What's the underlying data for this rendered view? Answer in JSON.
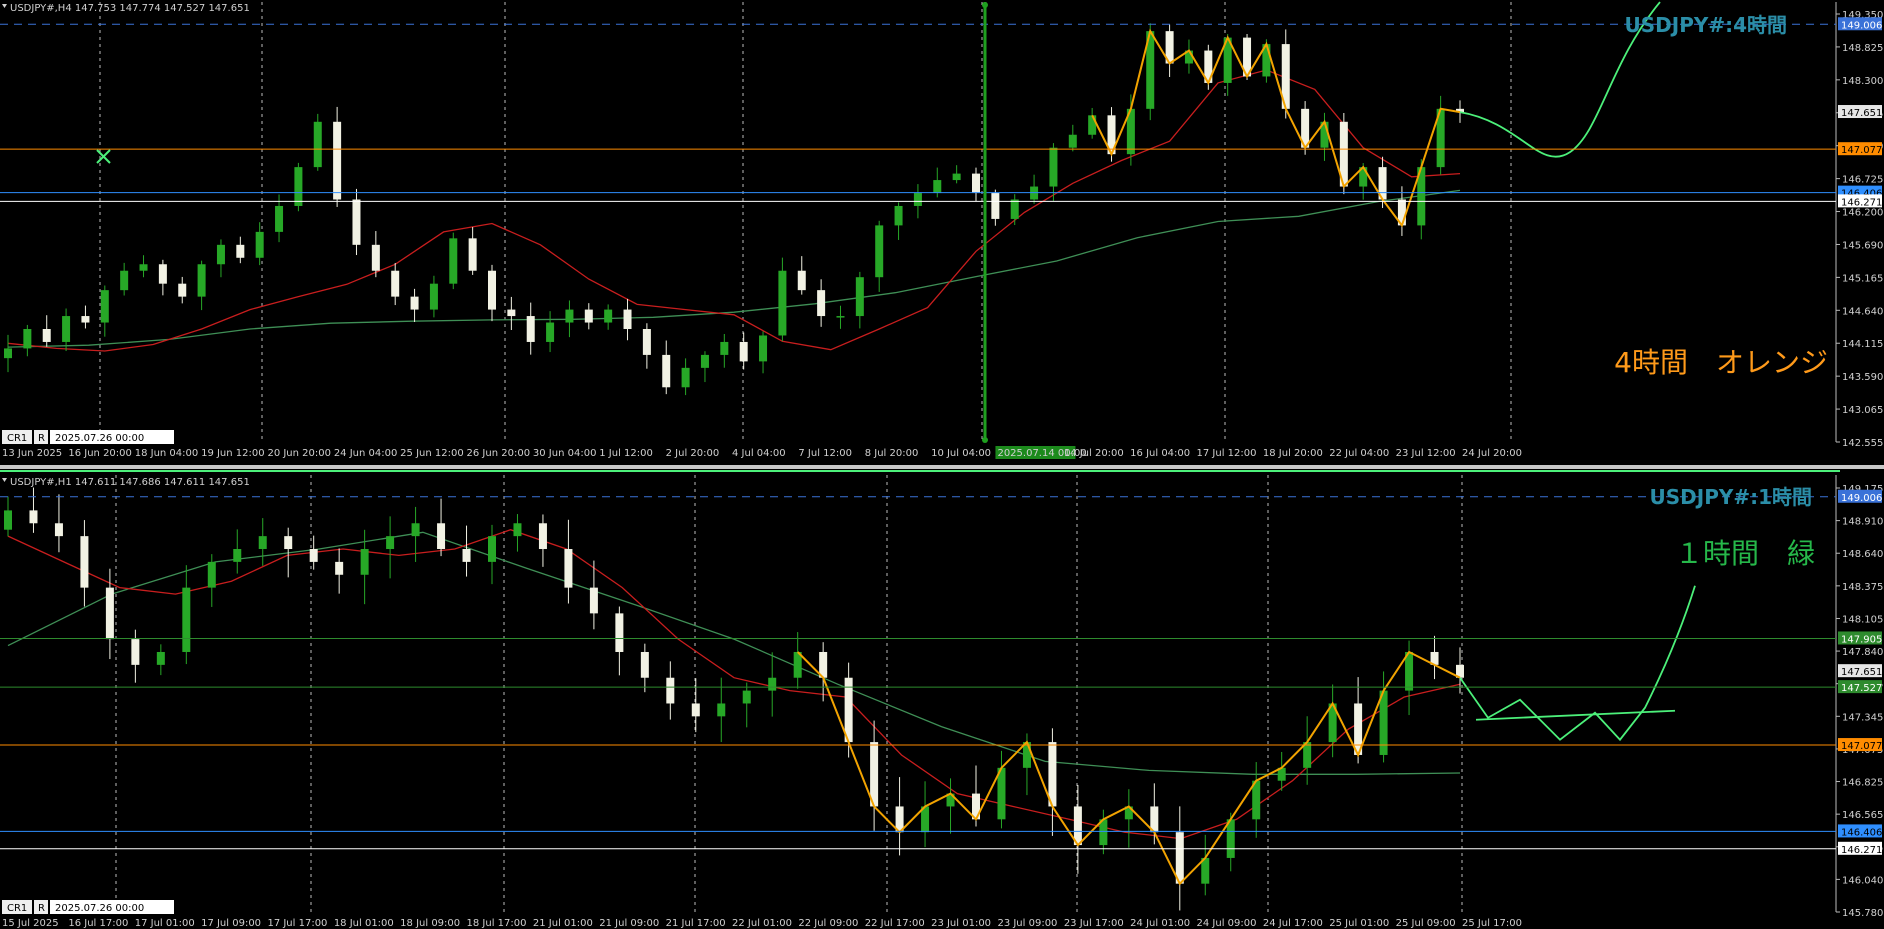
{
  "colors": {
    "background": "#000000",
    "bull_candle": "#27a827",
    "bear_candle": "#f2f2e4",
    "ma_fast": "#c81e1e",
    "ma_slow": "#3f8f56",
    "zigzag": "#f2a300",
    "forecast": "#4cf07a",
    "line_149": "#3a72d8",
    "line_147077": "#ff8c00",
    "line_146406": "#2f8fff",
    "line_146271": "#ffffff",
    "line_green": "#2e8b2e",
    "title_color": "#2b8ea8",
    "note_orange": "#ff9a1a",
    "note_green": "#26b84a",
    "axis_text": "#d0d0d0",
    "separator": "#c8c8c8"
  },
  "chart_data": [
    {
      "type": "candlestick",
      "symbol": "USDJPY#",
      "timeframe": "H4",
      "header": "USDJPY#,H4  147.753 147.774 147.527 147.651",
      "title": "USDJPY#:4時間",
      "annotation": "4時間　オレンジ",
      "ylim": [
        142.555,
        149.35
      ],
      "y_ticks": [
        "149.350",
        "148.825",
        "148.300",
        "147.775",
        "147.250",
        "146.725",
        "146.200",
        "145.690",
        "145.165",
        "144.640",
        "144.115",
        "143.590",
        "143.065",
        "142.555"
      ],
      "x_labels": [
        "13 Jun 2025",
        "16 Jun 20:00",
        "18 Jun 04:00",
        "19 Jun 12:00",
        "20 Jun 20:00",
        "24 Jun 04:00",
        "25 Jun 12:00",
        "26 Jun 20:00",
        "30 Jun 04:00",
        "1 Jul 12:00",
        "2 Jul 20:00",
        "4 Jul 04:00",
        "7 Jul 12:00",
        "8 Jul 20:00",
        "10 Jul 04:00",
        "2025.07.14 00:00",
        "14 Jul 20:00",
        "16 Jul 04:00",
        "17 Jul 12:00",
        "18 Jul 20:00",
        "22 Jul 04:00",
        "23 Jul 12:00",
        "24 Jul 20:00"
      ],
      "highlight_x_label": "2025.07.14 00:00",
      "date_box": "2025.07.26 00:00",
      "cr_label": "CR1",
      "r_label": "R",
      "price_tags": [
        {
          "value": "149.006",
          "kind": "blue_dash"
        },
        {
          "value": "147.651",
          "kind": "current"
        },
        {
          "value": "147.077",
          "kind": "orange"
        },
        {
          "value": "146.406",
          "kind": "blue"
        },
        {
          "value": "146.271",
          "kind": "white"
        }
      ],
      "horizontal_lines": [
        149.006,
        147.077,
        146.406,
        146.271
      ],
      "closes": [
        144.0,
        144.3,
        144.1,
        144.5,
        144.4,
        144.9,
        145.2,
        145.3,
        145.0,
        144.8,
        145.3,
        145.6,
        145.4,
        145.8,
        146.2,
        146.8,
        147.5,
        146.3,
        145.6,
        145.2,
        144.8,
        144.6,
        145.0,
        145.7,
        145.2,
        144.6,
        144.5,
        144.1,
        144.4,
        144.6,
        144.4,
        144.6,
        144.3,
        143.9,
        143.4,
        143.7,
        143.9,
        144.1,
        143.8,
        144.2,
        145.2,
        144.9,
        144.5,
        144.5,
        145.1,
        145.9,
        146.2,
        146.4,
        146.6,
        146.7,
        146.4,
        146.0,
        146.3,
        146.5,
        147.1,
        147.3,
        147.6,
        147.0,
        147.7,
        148.9,
        148.4,
        148.6,
        148.1,
        148.8,
        148.2,
        148.7,
        147.7,
        147.1,
        147.5,
        146.5,
        146.8,
        146.3,
        145.9,
        146.8,
        147.7,
        147.65
      ],
      "fast_ma": [
        144.08,
        144.0,
        143.96,
        144.06,
        144.3,
        144.6,
        144.8,
        144.99,
        145.3,
        145.8,
        145.93,
        145.6,
        145.07,
        144.68,
        144.6,
        144.52,
        144.11,
        143.98,
        144.3,
        144.63,
        145.5,
        146.1,
        146.55,
        146.9,
        147.2,
        148.1,
        148.3,
        148.0,
        147.1,
        146.65,
        146.7
      ],
      "slow_ma": [
        144.02,
        144.05,
        144.14,
        144.3,
        144.39,
        144.42,
        144.44,
        144.45,
        144.48,
        144.56,
        144.69,
        144.86,
        145.11,
        145.35,
        145.71,
        145.96,
        146.04,
        146.27,
        146.44
      ]
    },
    {
      "type": "candlestick",
      "symbol": "USDJPY#",
      "timeframe": "H1",
      "header": "USDJPY#,H1  147.611 147.686 147.611 147.651",
      "title": "USDJPY#:1時間",
      "annotation": "１時間　緑",
      "ylim": [
        145.78,
        149.175
      ],
      "y_ticks": [
        "149.175",
        "148.910",
        "148.640",
        "148.375",
        "148.105",
        "147.840",
        "147.575",
        "147.345",
        "147.075",
        "146.825",
        "146.565",
        "146.305",
        "146.040",
        "145.780"
      ],
      "x_labels": [
        "15 Jul 2025",
        "16 Jul 17:00",
        "17 Jul 01:00",
        "17 Jul 09:00",
        "17 Jul 17:00",
        "18 Jul 01:00",
        "18 Jul 09:00",
        "18 Jul 17:00",
        "21 Jul 01:00",
        "21 Jul 09:00",
        "21 Jul 17:00",
        "22 Jul 01:00",
        "22 Jul 09:00",
        "22 Jul 17:00",
        "23 Jul 01:00",
        "23 Jul 09:00",
        "23 Jul 17:00",
        "24 Jul 01:00",
        "24 Jul 09:00",
        "24 Jul 17:00",
        "25 Jul 01:00",
        "25 Jul 09:00",
        "25 Jul 17:00"
      ],
      "date_box": "2025.07.26 00:00",
      "cr_label": "CR1",
      "r_label": "R",
      "price_tags": [
        {
          "value": "149.006",
          "kind": "blue_dash"
        },
        {
          "value": "147.905",
          "kind": "green"
        },
        {
          "value": "147.651",
          "kind": "current"
        },
        {
          "value": "147.527",
          "kind": "green"
        },
        {
          "value": "147.077",
          "kind": "orange"
        },
        {
          "value": "146.406",
          "kind": "blue"
        },
        {
          "value": "146.271",
          "kind": "white"
        }
      ],
      "horizontal_lines": [
        149.006,
        147.905,
        147.527,
        147.077,
        146.406,
        146.271
      ],
      "closes": [
        148.9,
        148.8,
        148.7,
        148.3,
        147.9,
        147.7,
        147.8,
        148.3,
        148.5,
        148.6,
        148.7,
        148.6,
        148.5,
        148.4,
        148.6,
        148.7,
        148.8,
        148.6,
        148.5,
        148.7,
        148.8,
        148.6,
        148.3,
        148.1,
        147.8,
        147.6,
        147.4,
        147.3,
        147.4,
        147.5,
        147.6,
        147.8,
        147.6,
        147.1,
        146.6,
        146.4,
        146.6,
        146.7,
        146.5,
        146.9,
        147.1,
        146.6,
        146.3,
        146.5,
        146.6,
        146.4,
        146.0,
        146.2,
        146.5,
        146.8,
        146.9,
        147.1,
        147.4,
        147.0,
        147.5,
        147.8,
        147.7,
        147.6
      ],
      "fast_ma": [
        148.7,
        148.5,
        148.3,
        148.25,
        148.35,
        148.55,
        148.6,
        148.55,
        148.6,
        148.75,
        148.6,
        148.3,
        147.9,
        147.6,
        147.5,
        147.45,
        147.0,
        146.7,
        146.6,
        146.5,
        146.4,
        146.35,
        146.5,
        146.8,
        147.2,
        147.45,
        147.55
      ],
      "slow_ma": [
        147.85,
        148.25,
        148.5,
        148.6,
        148.73,
        148.45,
        148.18,
        147.9,
        147.55,
        147.22,
        146.95,
        146.88,
        146.85,
        146.85,
        146.86
      ]
    }
  ]
}
